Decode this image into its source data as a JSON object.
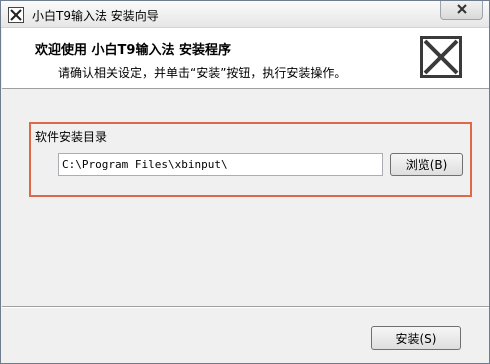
{
  "window": {
    "title": "小白T9输入法 安装向导"
  },
  "header": {
    "title": "欢迎使用 小白T9输入法 安装程序",
    "subtitle": "请确认相关设定，并单击“安装”按钮，执行安装操作。"
  },
  "install_dir": {
    "label": "软件安装目录",
    "path": "C:\\Program Files\\xbinput\\",
    "browse_label": "浏览(B)"
  },
  "footer": {
    "install_label": "安装(S)"
  },
  "colors": {
    "highlight_border": "#e0684a",
    "header_bg": "#ffffff",
    "window_bg": "#f0f0f0"
  },
  "icons": {
    "app": "app-icon",
    "close": "close-icon",
    "logo": "x-logo-icon"
  }
}
